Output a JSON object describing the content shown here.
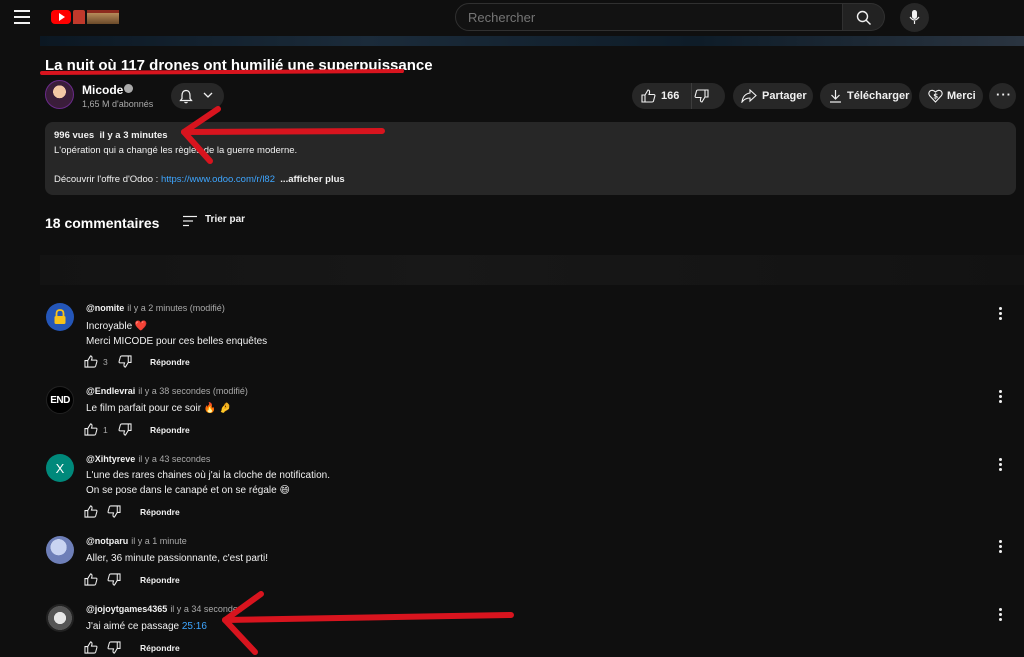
{
  "search": {
    "placeholder": "Rechercher"
  },
  "video": {
    "title": "La nuit où 117 drones ont humilié une superpuissance",
    "channel": "Micode",
    "subscribers": "1,65 M d'abonnés",
    "likes": "166",
    "actions": {
      "share": "Partager",
      "download": "Télécharger",
      "thanks": "Merci"
    }
  },
  "description": {
    "views": "996 vues",
    "date": "il y a 3 minutes",
    "line1": "L'opération qui a changé les règles de la guerre moderne.",
    "line2_prefix": "Découvrir l'offre d'Odoo : ",
    "line2_link": "https://www.odoo.com/r/l82",
    "more": "...afficher plus"
  },
  "comments_header": {
    "count": "18 commentaires",
    "sort": "Trier par"
  },
  "comments": [
    {
      "author": "@nomite",
      "time": "il y a 2 minutes (modifié)",
      "line1": "Incroyable ❤️",
      "line2": "Merci MICODE pour ces belles enquêtes",
      "likes": "3",
      "reply": "Répondre"
    },
    {
      "author": "@Endlevrai",
      "time": "il y a 38 secondes (modifié)",
      "line1": "Le film parfait pour ce soir 🔥 🤌",
      "likes": "1",
      "reply": "Répondre",
      "avatar_text": "END"
    },
    {
      "author": "@Xihtyreve",
      "time": "il y a 43 secondes",
      "line1": "L'une des rares chaines où j'ai la cloche de notification.",
      "line2": "On se pose dans le canapé et on se régale 😄",
      "likes": "",
      "reply": "Répondre",
      "avatar_text": "X"
    },
    {
      "author": "@notparu",
      "time": "il y a 1 minute",
      "line1": "Aller, 36 minute passionnante, c'est parti!",
      "likes": "",
      "reply": "Répondre"
    },
    {
      "author": "@jojoytgames4365",
      "time": "il y a 34 secondes",
      "line1": "J'ai aimé ce passage ",
      "timestamp": "25:16",
      "likes": "",
      "reply": "Répondre"
    }
  ],
  "colors": {
    "accent_red": "#d8141e",
    "link_blue": "#3ea6ff",
    "background": "#0f0f0f",
    "pill": "#272727"
  }
}
